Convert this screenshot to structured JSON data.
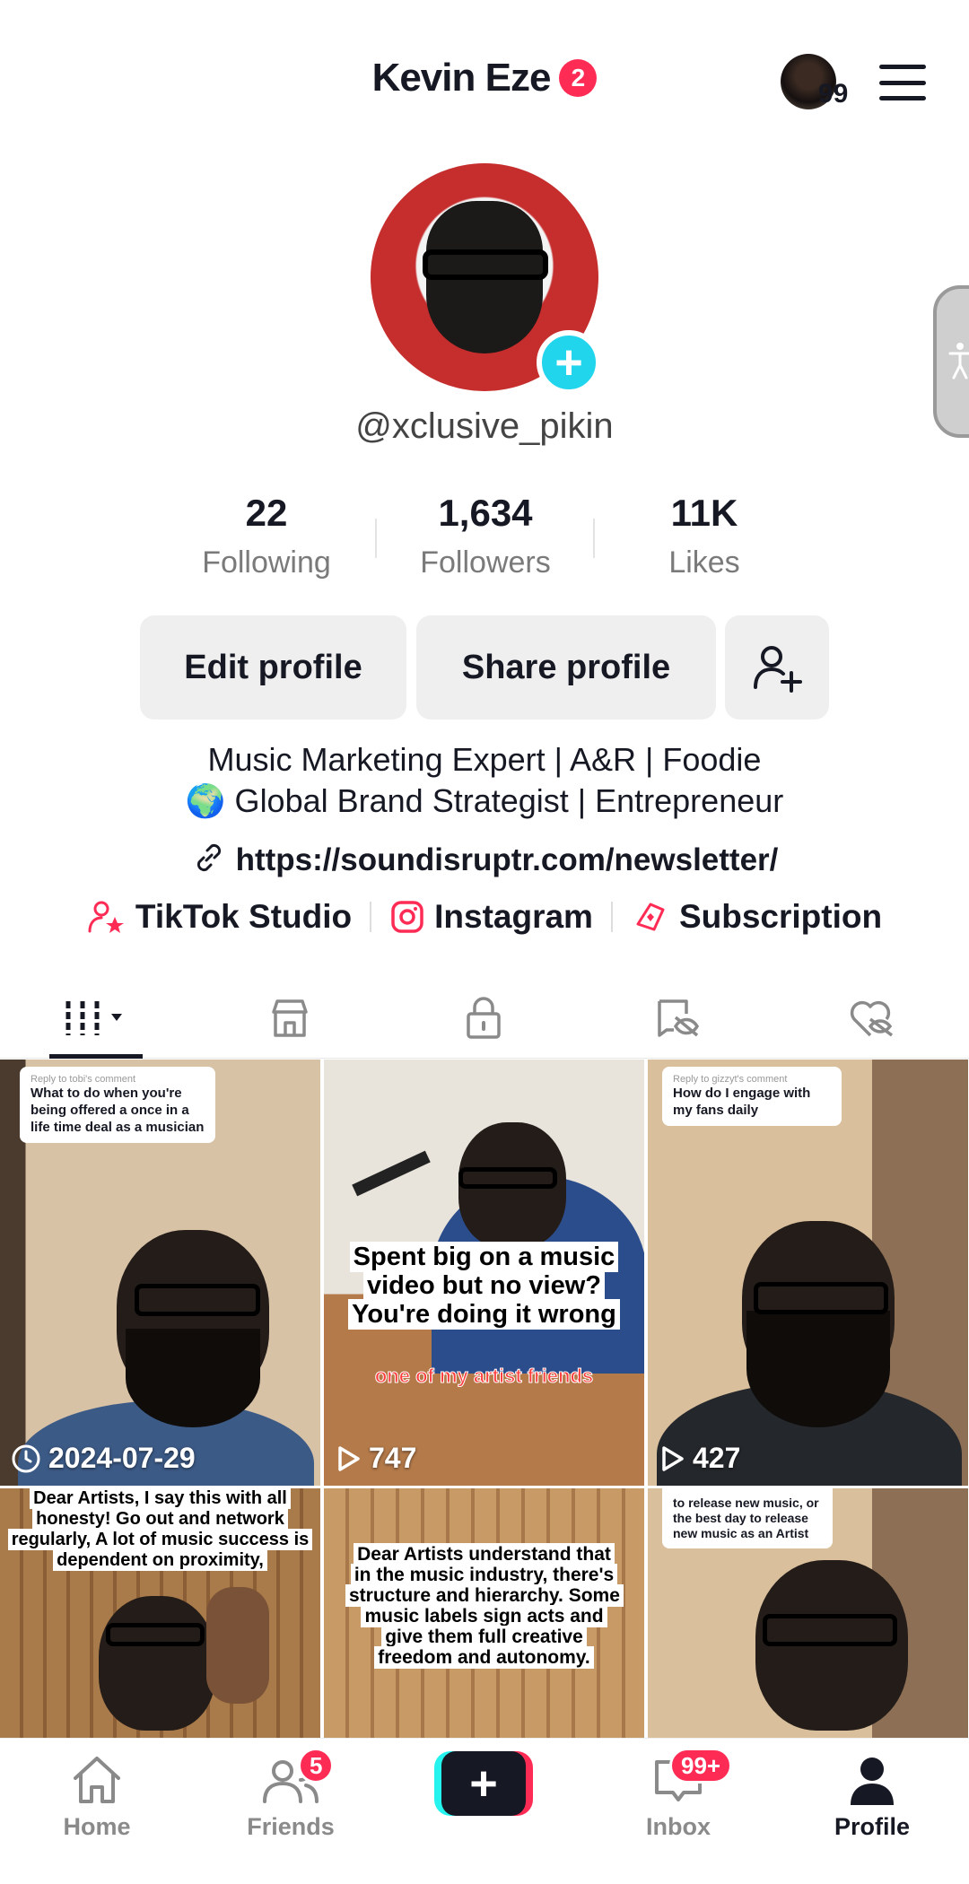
{
  "header": {
    "title": "Kevin Eze",
    "title_badge": "2",
    "story_count": "99"
  },
  "profile": {
    "username": "@xclusive_pikin",
    "stats": [
      {
        "value": "22",
        "label": "Following"
      },
      {
        "value": "1,634",
        "label": "Followers"
      },
      {
        "value": "11K",
        "label": "Likes"
      }
    ],
    "buttons": {
      "edit": "Edit profile",
      "share": "Share profile"
    },
    "bio_line1": "Music Marketing Expert | A&R | Foodie",
    "bio_line2": "🌍 Global Brand Strategist | Entrepreneur",
    "website": "https://soundisruptr.com/newsletter/",
    "links": [
      {
        "label": "TikTok Studio",
        "icon": "tiktok-studio-icon"
      },
      {
        "label": "Instagram",
        "icon": "instagram-icon"
      },
      {
        "label": "Subscription",
        "icon": "subscription-icon"
      }
    ]
  },
  "tabs": [
    "videos-grid-icon",
    "shop-icon",
    "private-lock-icon",
    "reposts-icon",
    "liked-hidden-icon"
  ],
  "videos": [
    {
      "reply_head": "Reply to tobi's comment",
      "reply_text": "What to do when you're being offered a once in a life time deal as a musician",
      "overlay": "2024-07-29",
      "overlay_icon": "clock-icon"
    },
    {
      "caption": "Spent big on a music video but no view? You're doing it wrong",
      "sub_caption": "one of my artist friends",
      "overlay": "747",
      "overlay_icon": "play-icon"
    },
    {
      "reply_head": "Reply to gizzyt's comment",
      "reply_text": "How do I engage with my fans daily",
      "overlay": "427",
      "overlay_icon": "play-icon"
    },
    {
      "caption": "Dear Artists, I say this with all honesty! Go out and network regularly, A lot of music success is dependent on proximity,"
    },
    {
      "caption": "Dear Artists understand that in the music industry, there's structure and hierarchy. Some music labels sign acts and give them full creative freedom and autonomy."
    },
    {
      "caption": "to release new music, or the best day to release new music as an Artist"
    }
  ],
  "bottom_nav": [
    {
      "label": "Home",
      "badge": ""
    },
    {
      "label": "Friends",
      "badge": "5"
    },
    {
      "label": "",
      "badge": ""
    },
    {
      "label": "Inbox",
      "badge": "99+"
    },
    {
      "label": "Profile",
      "badge": ""
    }
  ],
  "colors": {
    "accent": "#fe2c55",
    "cyan": "#20d5ec",
    "text": "#161823"
  }
}
